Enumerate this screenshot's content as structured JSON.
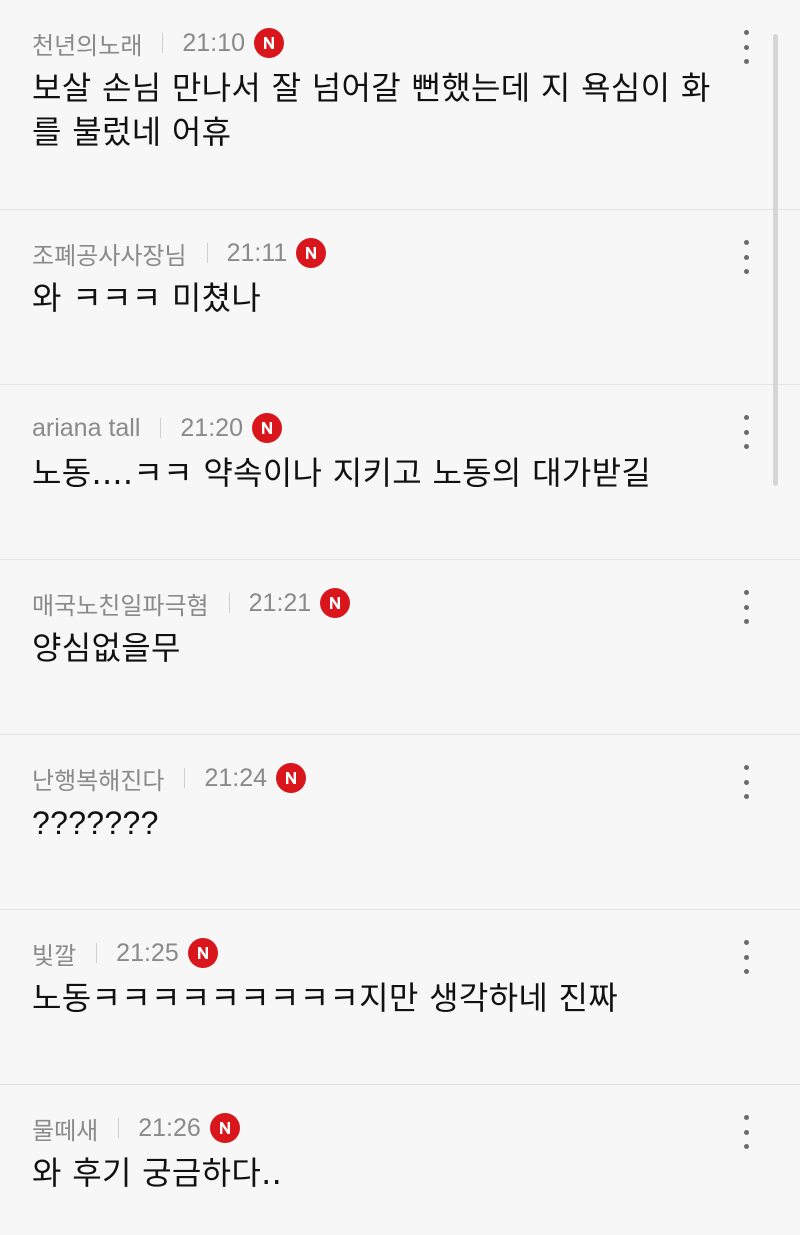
{
  "comments": [
    {
      "author": "천년의노래",
      "time": "21:10",
      "badge": "N",
      "text": "보살 손님 만나서 잘 넘어갈 뻔했는데 지 욕심이 화를 불렀네 어휴"
    },
    {
      "author": "조폐공사사장님",
      "time": "21:11",
      "badge": "N",
      "text": "와 ㅋㅋㅋ 미쳤나"
    },
    {
      "author": "ariana tall",
      "time": "21:20",
      "badge": "N",
      "text": "노동....ㅋㅋ 약속이나 지키고 노동의 대가받길"
    },
    {
      "author": "매국노친일파극혐",
      "time": "21:21",
      "badge": "N",
      "text": "양심없을무"
    },
    {
      "author": "난행복해진다",
      "time": "21:24",
      "badge": "N",
      "text": "???????"
    },
    {
      "author": "빛깔",
      "time": "21:25",
      "badge": "N",
      "text": "노동ㅋㅋㅋㅋㅋㅋㅋㅋㅋ지만 생각하네 진짜"
    },
    {
      "author": "물떼새",
      "time": "21:26",
      "badge": "N",
      "text": "와 후기 궁금하다.."
    }
  ],
  "colors": {
    "background": "#f7f7f7",
    "meta_text": "#8a8a8a",
    "body_text": "#111111",
    "new_badge": "#d9161c",
    "divider": "#e3e3e3"
  },
  "icons": {
    "new_badge": "new-badge-icon",
    "more": "more-vertical-icon"
  }
}
